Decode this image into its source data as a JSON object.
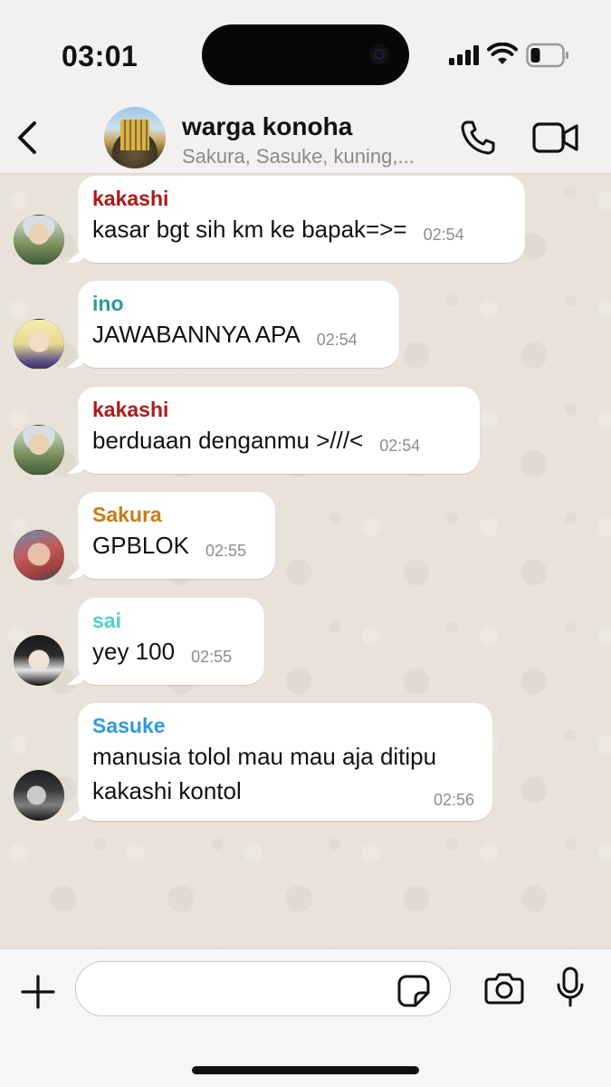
{
  "status_bar": {
    "time": "03:01"
  },
  "header": {
    "title": "warga konoha",
    "members": "Sakura, Sasuke, kuning,..."
  },
  "messages": [
    {
      "sender": "kakashi",
      "sender_color": "#b01818",
      "text": "kasar bgt sih km ke bapak=>=",
      "time": "02:54",
      "avatar": "kakashi-avatar"
    },
    {
      "sender": "ino",
      "sender_color": "#2a9aa0",
      "text": "JAWABANNYA APA",
      "time": "02:54",
      "avatar": "ino-avatar"
    },
    {
      "sender": "kakashi",
      "sender_color": "#b01818",
      "text": "berduaan denganmu >///<",
      "time": "02:54",
      "avatar": "kakashi-avatar"
    },
    {
      "sender": "Sakura",
      "sender_color": "#c97b1a",
      "text": "GPBLOK",
      "time": "02:55",
      "avatar": "sakura-avatar"
    },
    {
      "sender": "sai",
      "sender_color": "#4fd1c5",
      "text": "yey 100",
      "time": "02:55",
      "avatar": "sai-avatar"
    },
    {
      "sender": "Sasuke",
      "sender_color": "#2b9be0",
      "text_line1": "manusia tolol mau mau aja ditipu",
      "text_line2": "kakashi kontol",
      "time": "02:56",
      "avatar": "sasuke-avatar"
    }
  ],
  "input": {
    "value": "",
    "placeholder": ""
  },
  "icons": [
    "back-icon",
    "call-icon",
    "video-icon",
    "plus-icon",
    "sticker-icon",
    "camera-icon",
    "mic-icon",
    "signal-icon",
    "wifi-icon",
    "battery-icon"
  ]
}
